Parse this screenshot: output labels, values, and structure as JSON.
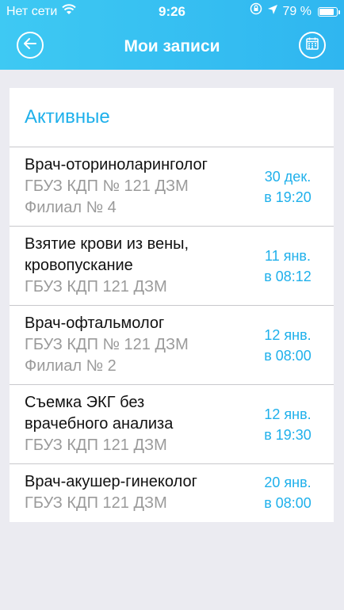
{
  "status_bar": {
    "carrier": "Нет сети",
    "time": "9:26",
    "battery": "79 %",
    "wifi_icon": "wifi-icon",
    "lock_icon": "rotation-lock-icon",
    "location_icon": "location-arrow-icon",
    "battery_level": 0.79
  },
  "header": {
    "title": "Мои записи",
    "back_icon": "arrow-left-icon",
    "calendar_icon": "calendar-icon"
  },
  "section": {
    "title": "Активные"
  },
  "appointments": [
    {
      "title": "Врач-оториноларинголог",
      "sub1": "ГБУЗ КДП № 121 ДЗМ",
      "sub2": "Филиал № 4",
      "date1": "30 дек.",
      "date2": "в 19:20"
    },
    {
      "title1": "Взятие крови из вены,",
      "title2": "кровопускание",
      "sub1": "ГБУЗ КДП 121 ДЗМ",
      "date1": "11 янв.",
      "date2": "в 08:12"
    },
    {
      "title": "Врач-офтальмолог",
      "sub1": "ГБУЗ КДП № 121 ДЗМ",
      "sub2": "Филиал № 2",
      "date1": "12 янв.",
      "date2": "в 08:00"
    },
    {
      "title1": "Съемка ЭКГ без",
      "title2": "врачебного анализа",
      "sub1": "ГБУЗ КДП 121 ДЗМ",
      "date1": "12 янв.",
      "date2": "в 19:30"
    },
    {
      "title": "Врач-акушер-гинеколог",
      "sub1": "ГБУЗ КДП 121 ДЗМ",
      "date1": "20 янв.",
      "date2": "в 08:00"
    }
  ],
  "colors": {
    "accent": "#1fb0eb",
    "header_bg": "#2fb6f0",
    "page_bg": "#ebebf1"
  }
}
